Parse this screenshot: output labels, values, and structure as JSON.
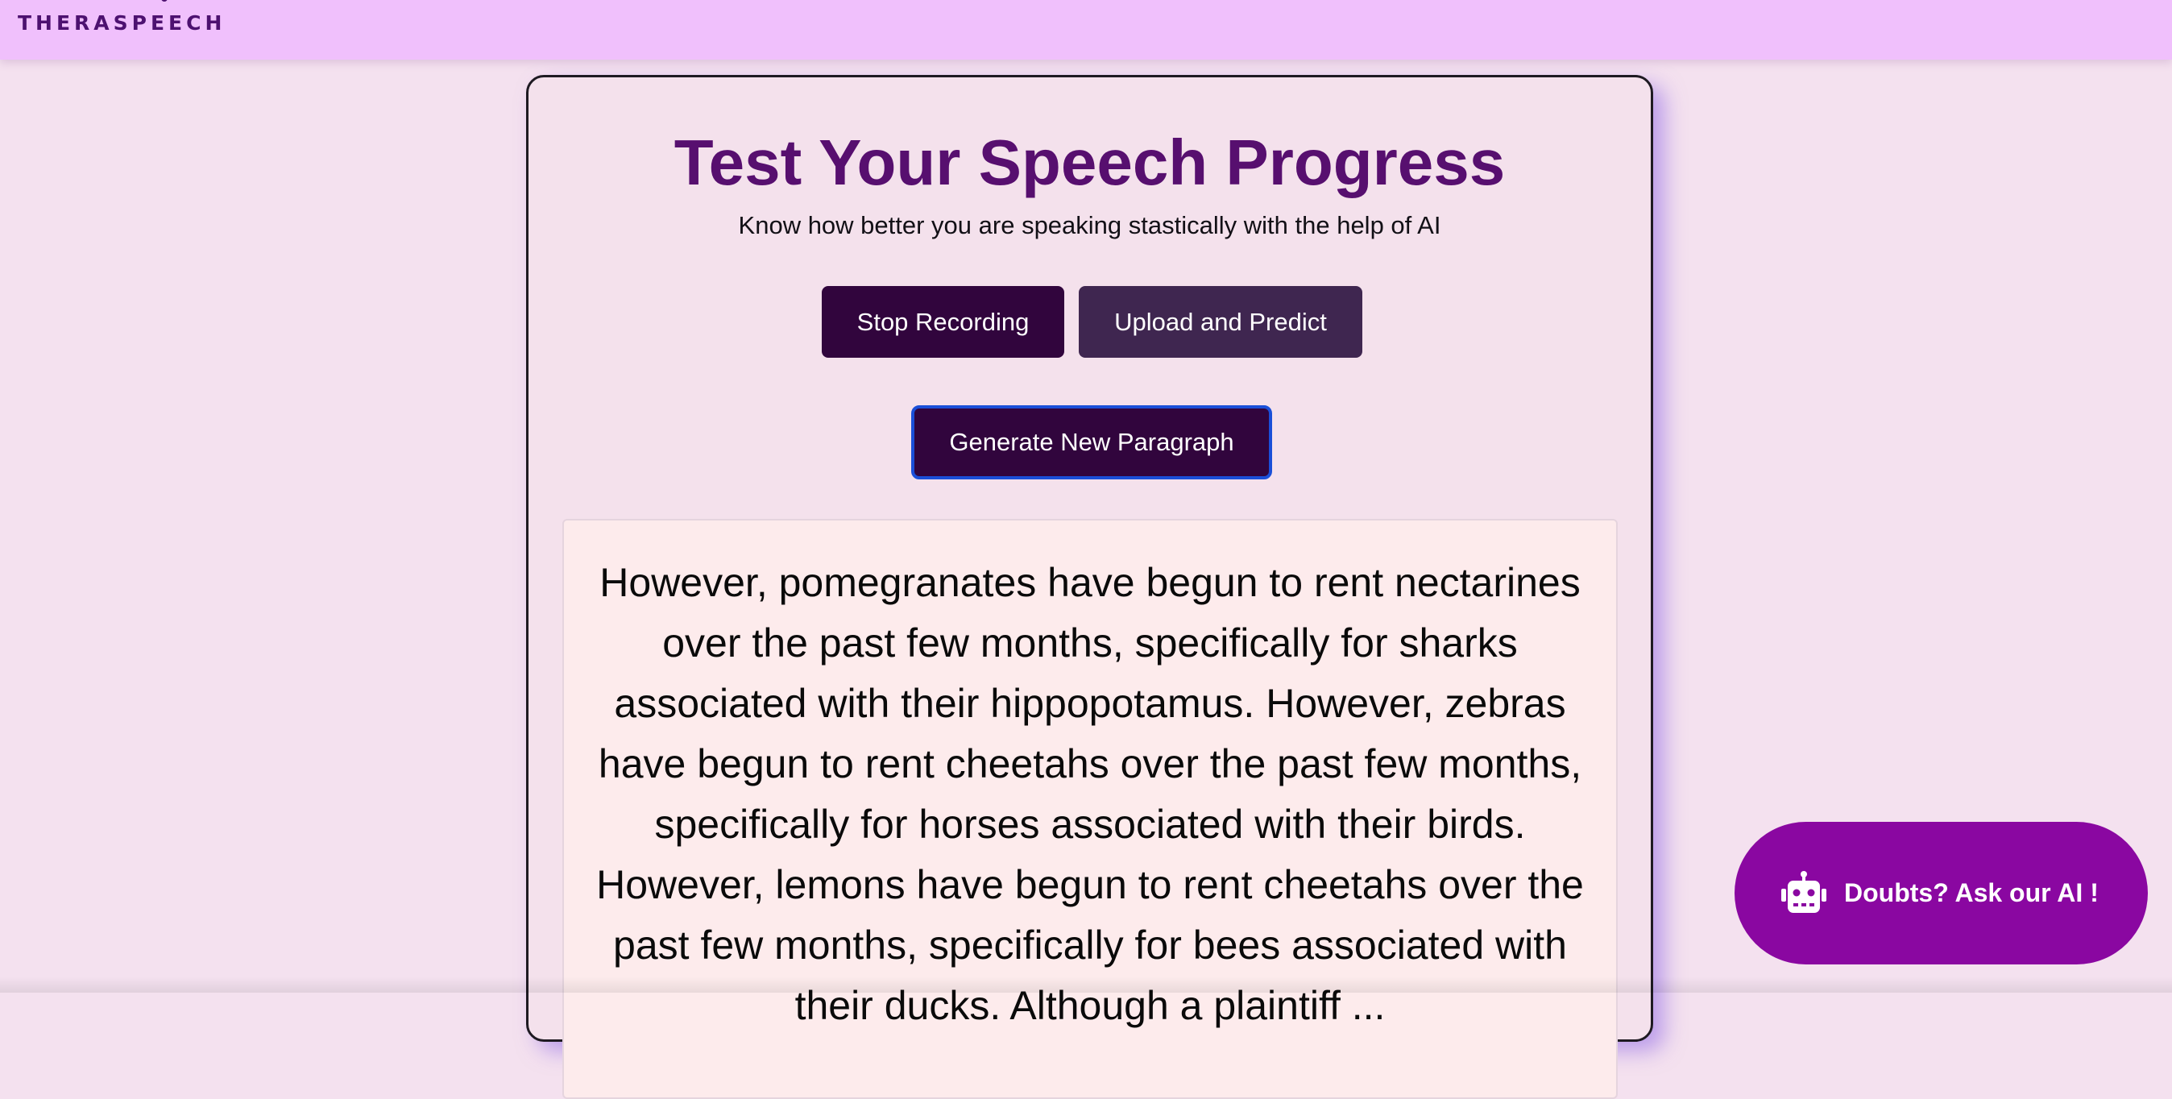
{
  "header": {
    "brand": "THERASPEECH"
  },
  "card": {
    "title": "Test Your Speech Progress",
    "subtitle": "Know how better you are speaking stastically with the help of AI",
    "buttons": {
      "stop_recording": "Stop Recording",
      "upload_predict": "Upload and Predict",
      "generate_paragraph": "Generate New Paragraph"
    },
    "paragraph": "However, pomegranates have begun to rent nectarines over the past few months, specifically for sharks associated with their hippopotamus. However, zebras have begun to rent cheetahs over the past few months, specifically for horses associated with their birds. However, lemons have begun to rent cheetahs over the past few months, specifically for bees associated with their ducks. Although a plaintiff ... "
  },
  "chat_widget": {
    "label": "Doubts? Ask our AI !",
    "icon": "robot-icon"
  },
  "colors": {
    "page_background": "#f4e1ef",
    "header_background": "#f0c0fc",
    "title_color": "#570f6f",
    "primary_button": "#31053d",
    "secondary_button": "#3f2650",
    "focus_ring": "#1a4fd8",
    "ai_button": "#8a07a1"
  }
}
